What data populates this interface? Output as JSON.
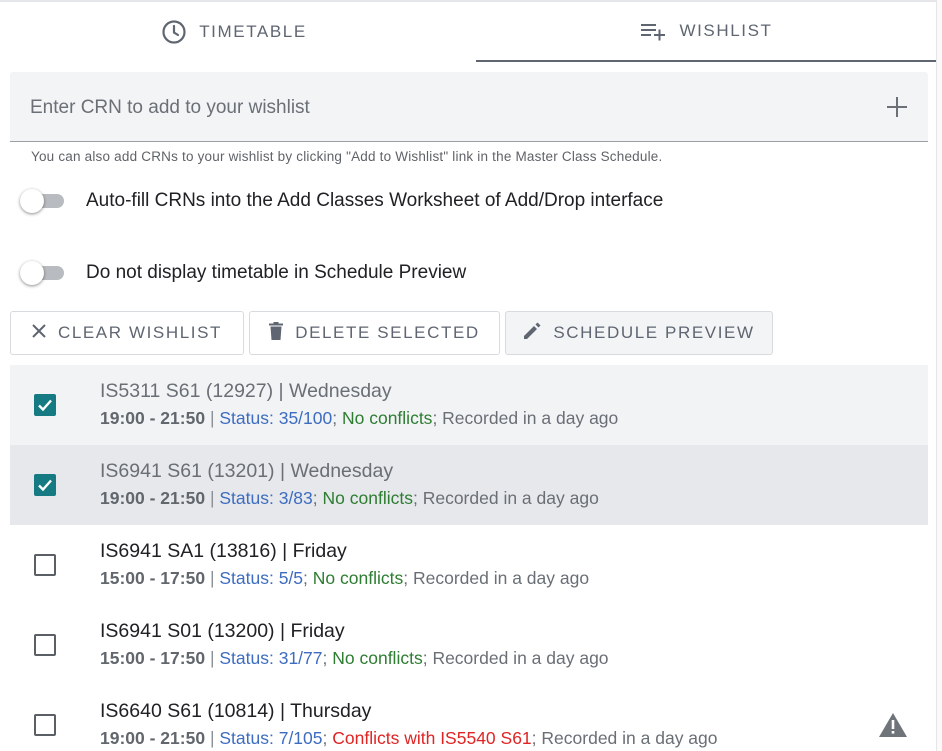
{
  "tabs": [
    {
      "label": "TIMETABLE",
      "icon": "clock-icon",
      "active": false
    },
    {
      "label": "WISHLIST",
      "icon": "playlist-add-icon",
      "active": true
    }
  ],
  "crn": {
    "placeholder": "Enter CRN to add to your wishlist",
    "value": ""
  },
  "hint": "You can also add CRNs to your wishlist by clicking \"Add to Wishlist\" link in the Master Class Schedule.",
  "toggles": [
    {
      "label": "Auto-fill CRNs into the Add Classes Worksheet of Add/Drop interface",
      "on": false
    },
    {
      "label": "Do not display timetable in Schedule Preview",
      "on": false
    }
  ],
  "buttons": {
    "clear": "CLEAR WISHLIST",
    "delete": "DELETE SELECTED",
    "preview": "SCHEDULE PREVIEW"
  },
  "courses": [
    {
      "title": "IS5311 S61 (12927)",
      "day": "Wednesday",
      "time": "19:00 - 21:50",
      "status": "Status: 35/100",
      "conflict": "No conflicts",
      "conflict_ok": true,
      "recorded": "Recorded in a day ago",
      "checked": true
    },
    {
      "title": "IS6941 S61 (13201)",
      "day": "Wednesday",
      "time": "19:00 - 21:50",
      "status": "Status: 3/83",
      "conflict": "No conflicts",
      "conflict_ok": true,
      "recorded": "Recorded in a day ago",
      "checked": true
    },
    {
      "title": "IS6941 SA1 (13816)",
      "day": "Friday",
      "time": "15:00 - 17:50",
      "status": "Status: 5/5",
      "conflict": "No conflicts",
      "conflict_ok": true,
      "recorded": "Recorded in a day ago",
      "checked": false
    },
    {
      "title": "IS6941 S01 (13200)",
      "day": "Friday",
      "time": "15:00 - 17:50",
      "status": "Status: 31/77",
      "conflict": "No conflicts",
      "conflict_ok": true,
      "recorded": "Recorded in a day ago",
      "checked": false
    },
    {
      "title": "IS6640 S61 (10814)",
      "day": "Thursday",
      "time": "19:00 - 21:50",
      "status": "Status: 7/105",
      "conflict": "Conflicts with IS5540 S61",
      "conflict_ok": false,
      "recorded": "Recorded in a day ago",
      "checked": false
    }
  ],
  "colors": {
    "accent": "#167a82",
    "status": "#3d6cc0",
    "ok": "#2e7d32",
    "conflict": "#e02424"
  }
}
